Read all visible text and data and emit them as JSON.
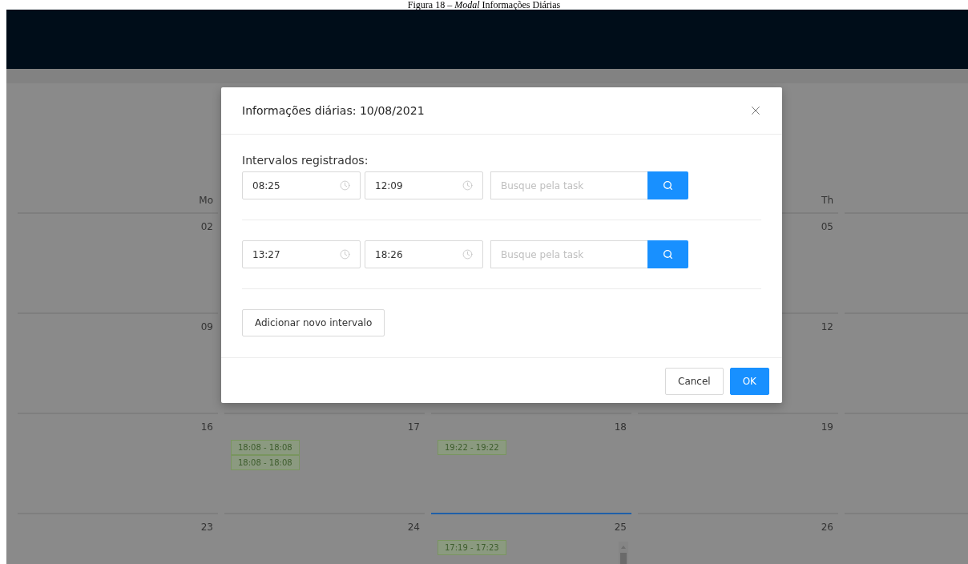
{
  "caption": "Figura 18 – *Modal* Informações Diárias",
  "calendar": {
    "columns": [
      {
        "label": "Mo"
      },
      {},
      {},
      {
        "label": "Th"
      },
      {}
    ],
    "weeks": [
      [
        {
          "kind": "day",
          "date": "02",
          "selected": false
        },
        {
          "kind": "covered"
        },
        {
          "kind": "covered"
        },
        {
          "kind": "day",
          "date": "05",
          "selected": false
        },
        {
          "kind": "day",
          "selected": false
        }
      ],
      [
        {
          "kind": "day",
          "date": "09",
          "selected": false
        },
        {
          "kind": "covered"
        },
        {
          "kind": "covered"
        },
        {
          "kind": "day",
          "date": "12",
          "selected": false
        },
        {
          "kind": "day",
          "selected": false
        }
      ],
      [
        {
          "kind": "day",
          "date": "16",
          "selected": false
        },
        {
          "kind": "day",
          "date": "17",
          "selected": false,
          "events": [
            "18:08 - 18:08",
            "18:08 - 18:08"
          ]
        },
        {
          "kind": "day",
          "date": "18",
          "selected": false,
          "events": [
            "19:22 - 19:22"
          ]
        },
        {
          "kind": "day",
          "date": "19",
          "selected": false
        },
        {
          "kind": "day",
          "selected": false
        }
      ],
      [
        {
          "kind": "day",
          "date": "23",
          "selected": false
        },
        {
          "kind": "day",
          "date": "24",
          "selected": false
        },
        {
          "kind": "day",
          "date": "25",
          "selected": true,
          "events": [
            "17:19 - 17:23"
          ]
        },
        {
          "kind": "day",
          "date": "26",
          "selected": false
        },
        {
          "kind": "day",
          "selected": false
        }
      ]
    ]
  },
  "modal": {
    "title": "Informações diárias: 10/08/2021",
    "section_label": "Intervalos registrados:",
    "intervals": [
      {
        "start": "08:25",
        "end": "12:09",
        "task_placeholder": "Busque pela task"
      },
      {
        "start": "13:27",
        "end": "18:26",
        "task_placeholder": "Busque pela task"
      }
    ],
    "add_button": "Adicionar novo intervalo",
    "buttons": [
      {
        "label": "Cancel",
        "kind": "default"
      },
      {
        "label": "OK",
        "kind": "primary"
      }
    ]
  }
}
